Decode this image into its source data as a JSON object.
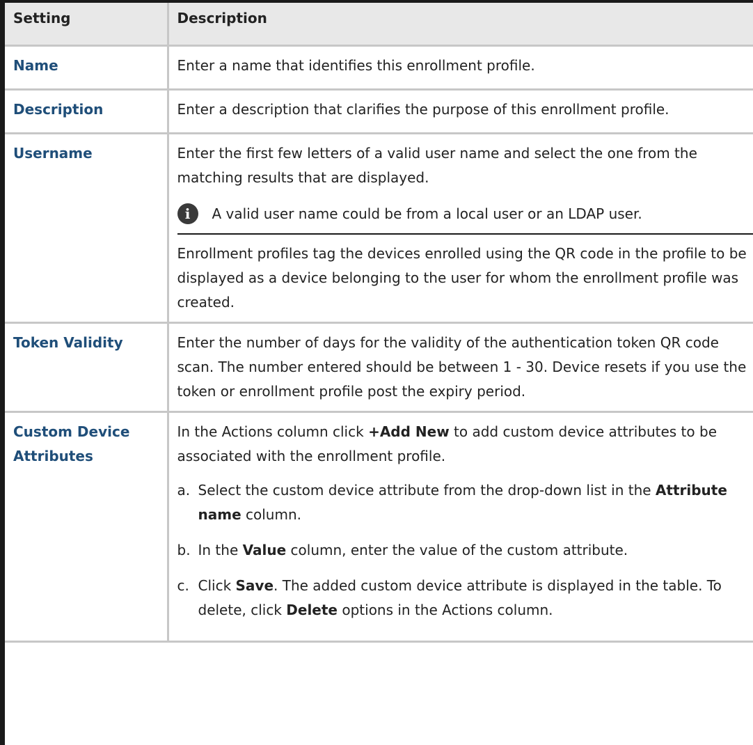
{
  "header": {
    "setting": "Setting",
    "description": "Description"
  },
  "rows": {
    "name": {
      "setting": "Name",
      "description": "Enter a name that identifies this enrollment profile."
    },
    "description": {
      "setting": "Description",
      "description": "Enter a description that clarifies the purpose of this enrollment profile."
    },
    "username": {
      "setting": "Username",
      "description": "Enter the first few letters of a valid user name and select the one from the matching results that are displayed.",
      "note": "A valid user name could be from a local user or an LDAP user.",
      "extra": "Enrollment profiles tag the devices enrolled using the QR code in the profile to be displayed as a device belonging to the user for whom the enrollment profile was created."
    },
    "token": {
      "setting": "Token Validity",
      "description": "Enter the number of days for the validity of the authentication token QR code scan. The number entered should be between 1 - 30. Device resets if you use the token or enrollment profile post the expiry period."
    },
    "custom": {
      "setting": "Custom Device Attributes",
      "intro_pre": "In the Actions column click ",
      "intro_bold": "+Add New",
      "intro_post": " to add custom device attributes to be associated with the enrollment profile.",
      "steps": {
        "a": {
          "mark": "a.",
          "pre": "Select the custom device attribute from the drop-down list in the ",
          "bold": "Attribute name",
          "post": " column."
        },
        "b": {
          "mark": "b.",
          "pre": "In the ",
          "bold": "Value",
          "post": " column, enter the value of the custom attribute."
        },
        "c": {
          "mark": "c.",
          "pre": "Click ",
          "bold": "Save",
          "mid": ". The added custom device attribute is displayed in the table. To delete, click ",
          "bold2": "Delete",
          "post": " options in the Actions column."
        }
      }
    }
  },
  "icons": {
    "note_icon": "info-icon"
  }
}
